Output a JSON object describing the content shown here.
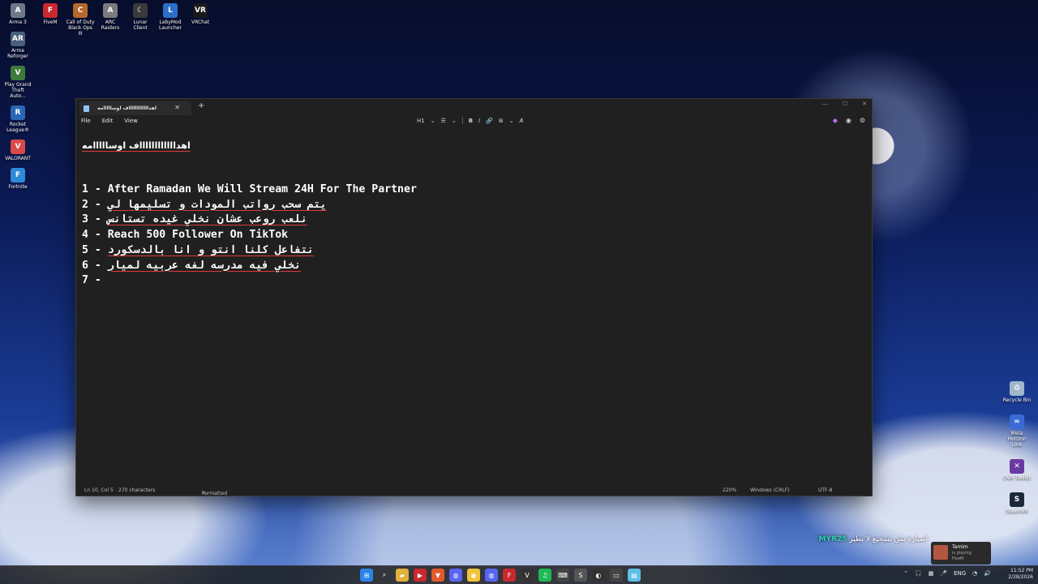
{
  "desktop": {
    "left_icons": [
      "Arma 3",
      "Arma Reforger",
      "Play Grand Theft Auto...",
      "Rocket League®",
      "VALORANT",
      "Fortnite"
    ],
    "top_icons": [
      "FiveM",
      "Call of Duty Black Ops III",
      "ARC Raiders",
      "Lunar Client",
      "LabyMod Launcher",
      "VRChat"
    ],
    "right_icons": [
      "Recycle Bin",
      "Meta Horizon Link",
      "OVR Toolkit",
      "SteamVR"
    ]
  },
  "notepad": {
    "tab_title": "اهدااااااااااااف اوسااااامه",
    "menu": {
      "file": "File",
      "edit": "Edit",
      "view": "View"
    },
    "toolbar": {
      "heading": "H1",
      "list": "☰",
      "bold": "B",
      "italic": "I",
      "link": "🔗",
      "table": "⊞",
      "clear": "A̸"
    },
    "heading_text": "اهدااااااااااااف اوسااااامه",
    "lines": [
      {
        "num": "1",
        "text": "After Ramadan We Will Stream 24H For The Partner",
        "rtl": false
      },
      {
        "num": "2",
        "text": "يتم سحب رواتب المودات و تسليمها لي",
        "rtl": true
      },
      {
        "num": "3",
        "text": "نلعب روعب عشان نخلي غيده تستانس",
        "rtl": true
      },
      {
        "num": "4",
        "text": "Reach 500 Follower On TikTok",
        "rtl": false
      },
      {
        "num": "5",
        "text": "نتفاعل كلنا انتو و انا بالدسكورد",
        "rtl": true
      },
      {
        "num": "6",
        "text": "نخلي فيه مدرسه لغه عربيه لميار",
        "rtl": true
      },
      {
        "num": "7",
        "text": "",
        "rtl": false
      }
    ],
    "status": {
      "position": "Ln 10, Col 5",
      "chars": "270 characters",
      "mode": "Formatted",
      "zoom": "220%",
      "line_ending": "Windows (CRLF)",
      "encoding": "UTF-8"
    }
  },
  "overlay": {
    "name": "MYR25",
    "message": "اصبارة بس تشجيع لا يطير"
  },
  "popup": {
    "user": "Tamim",
    "status": "is playing",
    "game": "FiveM"
  },
  "taskbar": {
    "language": "ENG",
    "time": "11:52 PM",
    "date": "2/28/2026"
  },
  "colors": {
    "editor_bg": "#202020",
    "accent": "#e03a3a"
  }
}
